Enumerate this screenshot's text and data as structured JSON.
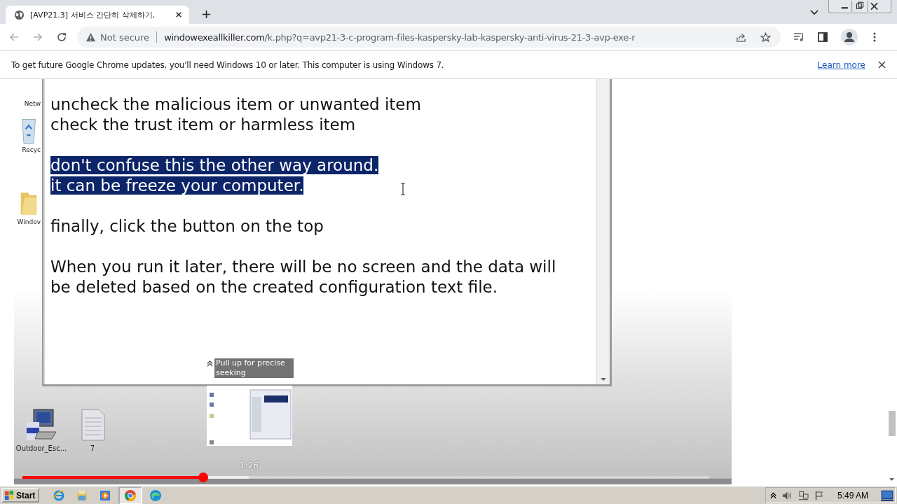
{
  "browser": {
    "tab": {
      "title": "[AVP21.3] 서비스 간단히 삭제하기,",
      "selected": true
    },
    "address": {
      "security": "Not secure",
      "host": "windowexeallkiller.com",
      "path": "/k.php?q=avp21-3-c-program-files-kaspersky-lab-kaspersky-anti-virus-21-3-avp-exe-r"
    },
    "infobar": {
      "message": "To get future Google Chrome updates, you'll need Windows 10 or later. This computer is using Windows 7.",
      "link": "Learn more"
    }
  },
  "video": {
    "desktop_icons": [
      {
        "label": "Netw",
        "kind": "network"
      },
      {
        "label": "Recyc",
        "kind": "recycle"
      },
      {
        "label": "Windov",
        "kind": "folder"
      }
    ],
    "bottom_icons": [
      {
        "label": "Outdoor_Esc...",
        "kind": "setup"
      },
      {
        "label": "7",
        "kind": "file"
      }
    ],
    "document": {
      "paragraphs": [
        {
          "selected": false,
          "lines": [
            "uncheck the malicious item or unwanted item",
            "check the trust item or harmless item"
          ]
        },
        {
          "selected": true,
          "lines": [
            "don't confuse this the other way around.",
            "it can be freeze your computer."
          ]
        },
        {
          "selected": false,
          "lines": [
            "finally, click the button on the top"
          ]
        },
        {
          "selected": false,
          "lines": [
            "When you run it later, there will be no screen and the data will",
            "be deleted based on the created configuration text file."
          ]
        }
      ]
    },
    "seek_hint": "Pull up for precise seeking",
    "seek_time": "1:26",
    "progress": {
      "level": 0.263
    }
  },
  "taskbar": {
    "start": "Start",
    "apps": [
      {
        "kind": "ie",
        "selected": false
      },
      {
        "kind": "explorer",
        "selected": false
      },
      {
        "kind": "media",
        "selected": false
      },
      {
        "kind": "chrome",
        "selected": true
      },
      {
        "kind": "edge",
        "selected": false
      }
    ],
    "clock": "5:49 AM"
  }
}
